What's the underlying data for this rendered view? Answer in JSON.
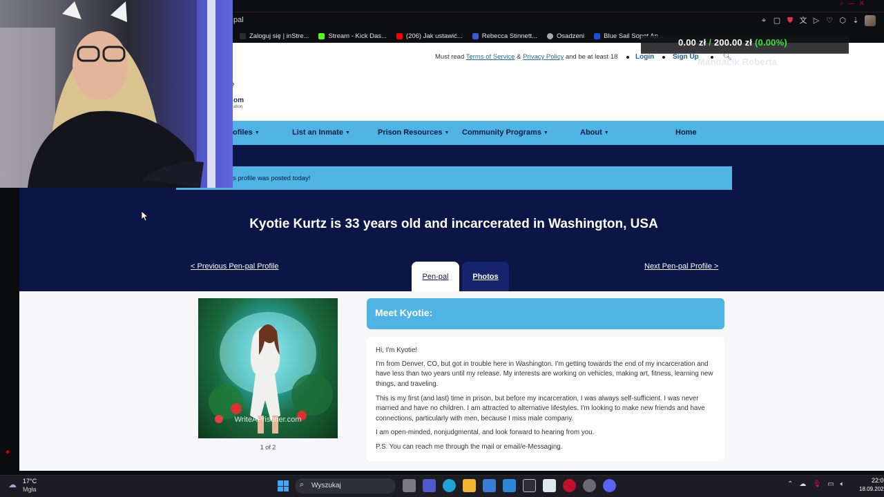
{
  "browser": {
    "tab_title": "pal",
    "bookmarks": [
      {
        "label": "Zaloguj się | inStre...",
        "color": "#2b2b2b"
      },
      {
        "label": "Stream - Kick Das...",
        "color": "#53fc18"
      },
      {
        "label": "(206) Jak ustawić...",
        "color": "#ff0000"
      },
      {
        "label": "Rebecca Stinnett...",
        "color": "#3a5bd6"
      },
      {
        "label": "Osadzeni",
        "color": "#aaaaaa"
      },
      {
        "label": "Blue Sail Sopot Ap...",
        "color": "#1a4fd6"
      }
    ]
  },
  "site": {
    "topline_prefix": "Must read",
    "tos": "Terms of Service",
    "amp": "&",
    "privacy": "Privacy Policy",
    "topline_suffix": "and be at least 18",
    "login": "Login",
    "signup": "Sign Up",
    "logo_text": "om",
    "logo_sub": "ation",
    "nav": [
      {
        "label": "ofiles"
      },
      {
        "label": "List an Inmate"
      },
      {
        "label": "Prison Resources"
      },
      {
        "label": "Community Programs"
      },
      {
        "label": "About"
      },
      {
        "label": "Home"
      }
    ],
    "notice": "s profile was posted today!",
    "headline": "Kyotie Kurtz is 33 years old and incarcerated in Washington, USA",
    "prev": "< Previous Pen-pal Profile",
    "next": "Next Pen-pal Profile >",
    "tab_penpal": "Pen-pal",
    "tab_photos": "Photos",
    "photo_caption": "1 of 2",
    "watermark": "WriteAPrisoner.com",
    "meet_title": "Meet Kyotie:",
    "bio": [
      "Hi, I'm Kyotie!",
      "I'm from Denver, CO, but got in trouble here in Washington. I'm getting towards the end of my incarceration and have less than two years until my release. My interests are working on vehicles, making art, fitness, learning new things, and traveling.",
      "This is my first (and last) time in prison, but before my incarceration, I was always self-sufficient. I was never married and have no children. I am attracted to alternative lifestyles. I'm looking to make new friends and have connections, particularly with men, because I miss male company.",
      "I am open-minded, nonjudgmental, and look forward to hearing from you.",
      "P.S. You can reach me through the mail or email/e-Messaging."
    ]
  },
  "overlay": {
    "donation_amount": "0.00 zł",
    "donation_sep": "/",
    "donation_goal": "200.00 zł",
    "donation_pct": "(0.00%)",
    "donor": "Mandacik Roberta"
  },
  "taskbar": {
    "temp": "17°C",
    "weather": "Mgła",
    "search": "Wyszukaj",
    "time": "22:0",
    "date": "18.09.202"
  }
}
